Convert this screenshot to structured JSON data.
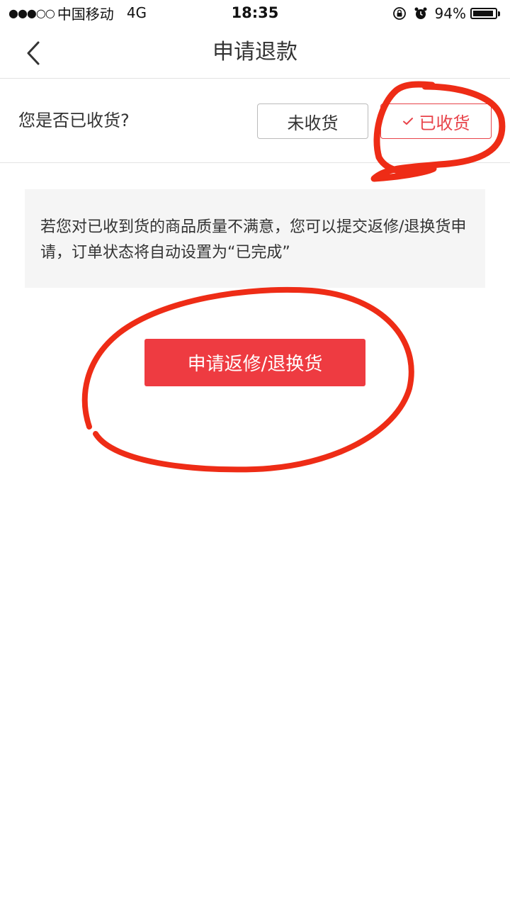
{
  "status_bar": {
    "signal": "●●●○○",
    "carrier": "中国移动",
    "network": "4G",
    "time": "18:35",
    "battery_percent": "94%",
    "battery_level": 0.94,
    "icons": [
      "orientation-lock-icon",
      "alarm-icon",
      "battery-icon"
    ]
  },
  "nav": {
    "back_icon": "chevron-left-icon",
    "title": "申请退款"
  },
  "received": {
    "question": "您是否已收货?",
    "option_not_received": "未收货",
    "option_received": "已收货",
    "selected": "已收货"
  },
  "info": {
    "text": "若您对已收到货的商品质量不满意，您可以提交返修/退换货申请，订单状态将自动设置为“已完成”"
  },
  "action": {
    "button_label": "申请返修/退换货"
  },
  "colors": {
    "accent": "#ee3b41",
    "selected_border": "#e8434a",
    "annotation": "#ee2c16"
  }
}
